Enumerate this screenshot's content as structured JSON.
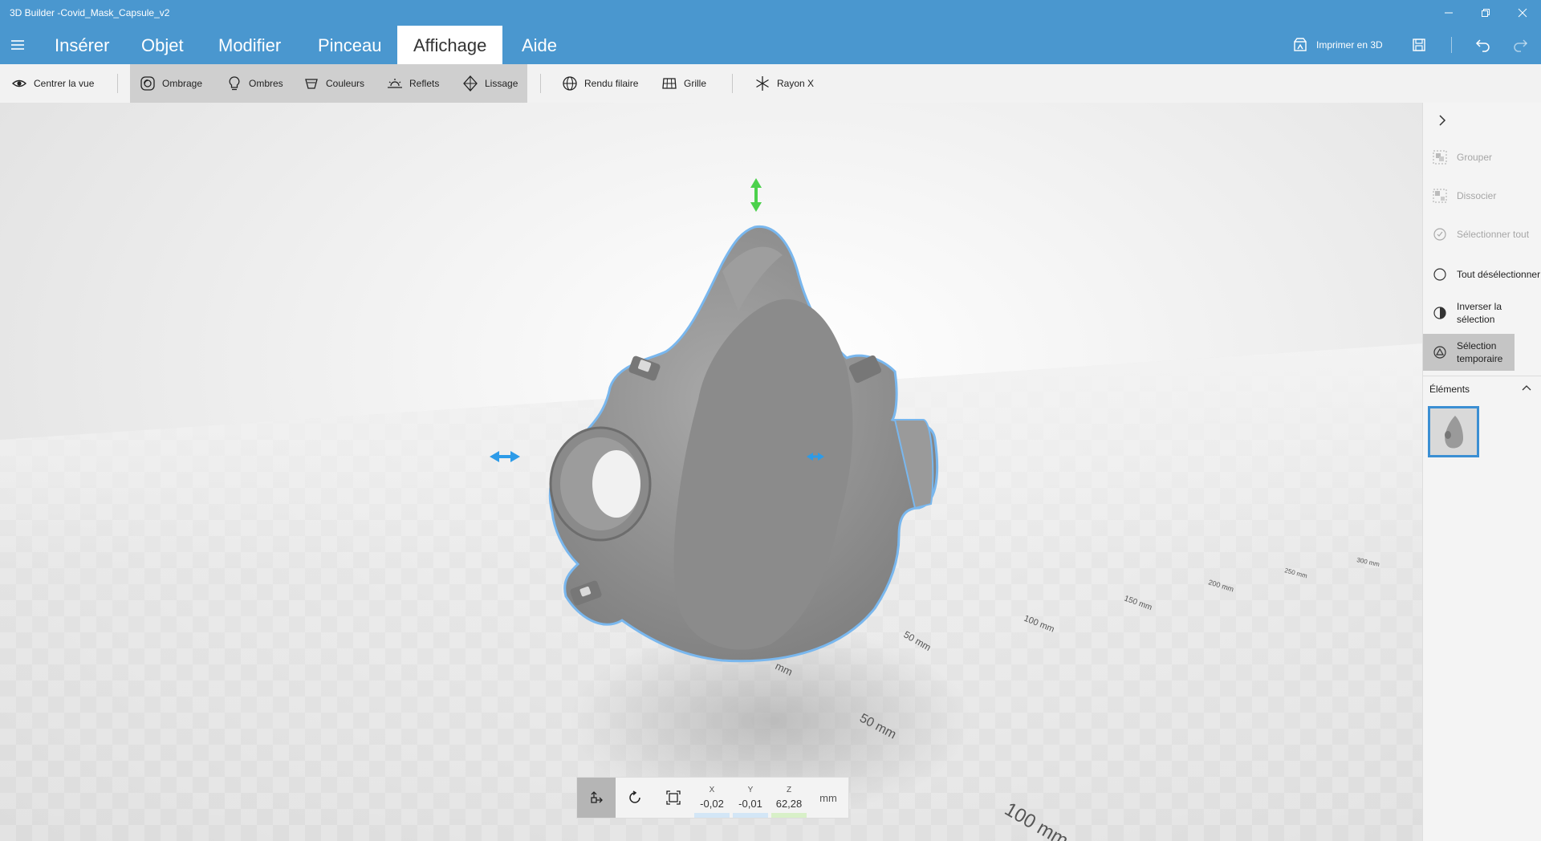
{
  "window": {
    "title": "3D Builder -Covid_Mask_Capsule_v2"
  },
  "menu": {
    "tabs": [
      {
        "label": "Insérer"
      },
      {
        "label": "Objet"
      },
      {
        "label": "Modifier"
      },
      {
        "label": "Pinceau"
      },
      {
        "label": "Affichage"
      },
      {
        "label": "Aide"
      }
    ],
    "active_tab": "Affichage",
    "print_label": "Imprimer en 3D"
  },
  "toolbar": {
    "center_view": "Centrer la vue",
    "shading": "Ombrage",
    "shadows": "Ombres",
    "colors": "Couleurs",
    "reflections": "Reflets",
    "smoothing": "Lissage",
    "wireframe": "Rendu filaire",
    "grid": "Grille",
    "xray": "Rayon X"
  },
  "scene": {
    "ruler_labels": [
      "mm",
      "50 mm",
      "100 mm",
      "50 mm",
      "100 mm",
      "150 mm",
      "200 mm",
      "250 mm",
      "300 mm"
    ]
  },
  "transform": {
    "x_label": "X",
    "y_label": "Y",
    "z_label": "Z",
    "x_value": "-0,02",
    "y_value": "-0,01",
    "z_value": "62,28",
    "unit": "mm"
  },
  "panel": {
    "items": [
      {
        "label": "Grouper",
        "enabled": false
      },
      {
        "label": "Dissocier",
        "enabled": false
      },
      {
        "label": "Sélectionner tout",
        "enabled": false
      },
      {
        "label": "Tout désélectionner",
        "enabled": true
      },
      {
        "label": "Inverser la sélection",
        "enabled": true
      },
      {
        "label": "Sélection temporaire",
        "enabled": true,
        "active": true
      }
    ],
    "elements_header": "Éléments"
  },
  "colors": {
    "accent": "#4a97cf",
    "selection_outline": "#6fb2ea",
    "gizmo_blue": "#2d9be8",
    "gizmo_green": "#4cd14c"
  }
}
